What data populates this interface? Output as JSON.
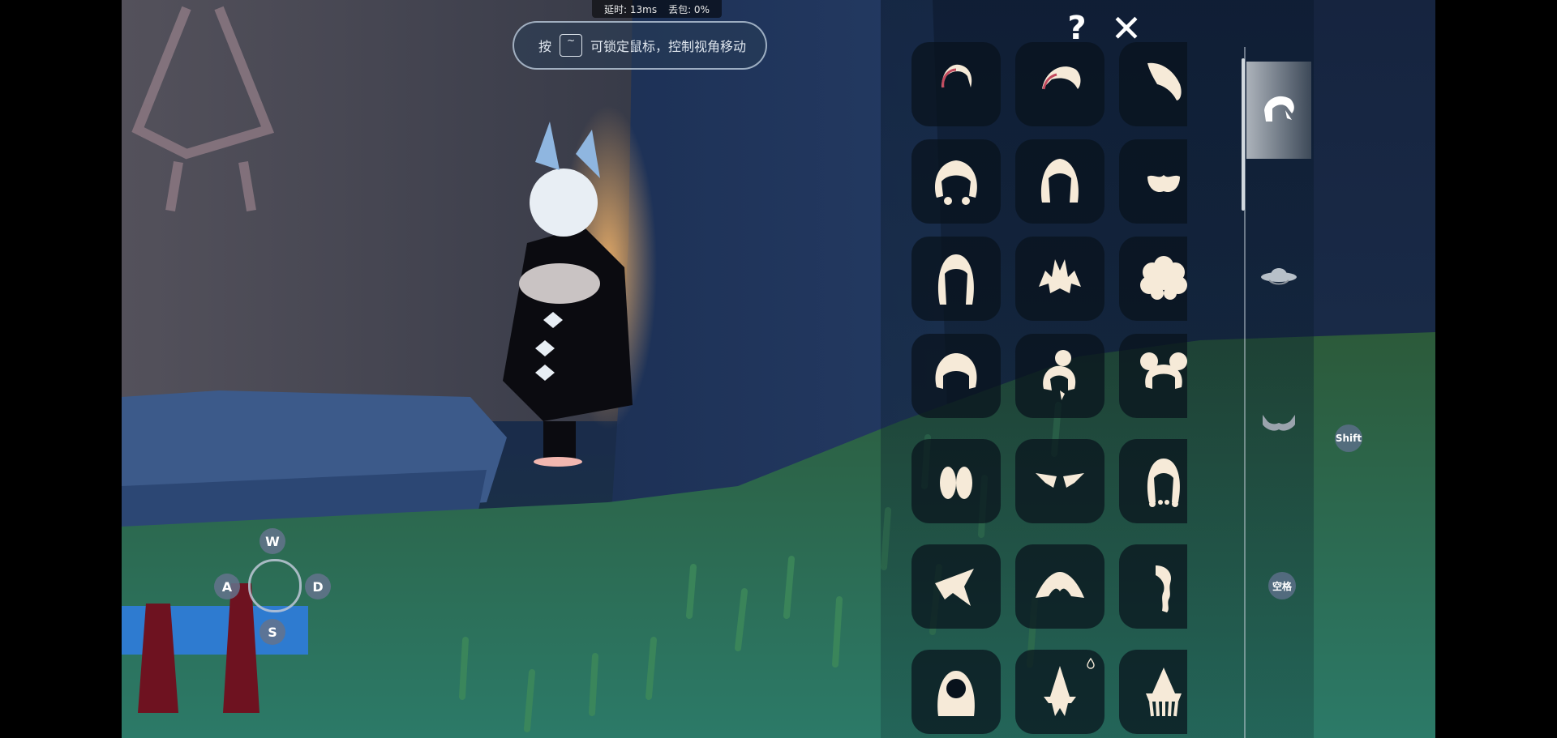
{
  "net_stats": {
    "latency": "延时: 13ms",
    "packet_loss": "丢包: 0%"
  },
  "hint": {
    "press": "按",
    "key": "~",
    "message": "可锁定鼠标，控制视角移动"
  },
  "panel": {
    "help": "?",
    "close": "✕"
  },
  "badges": {
    "shift": "Shift",
    "space": "空格"
  },
  "controls": {
    "up": "W",
    "left": "A",
    "right": "D",
    "down": "S"
  },
  "categories": [
    "hair-icon",
    "hat-icon",
    "horns-icon"
  ],
  "colors": {
    "tile_bg": "#08121c",
    "icon_fill": "#f6ead8",
    "badge": "#5a6e87"
  }
}
